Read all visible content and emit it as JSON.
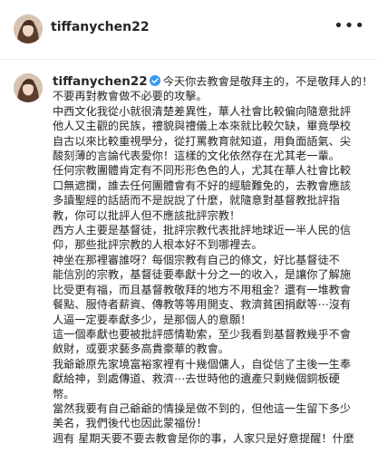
{
  "header": {
    "username": "tiffanychen22",
    "more_icon": "more-horizontal-icon"
  },
  "caption": {
    "username": "tiffanychen22",
    "verified_icon": "verified-badge-icon",
    "lines": [
      "今天你去教會是敬拜主的，不是敬拜人的！",
      "不要再對教會做不必要的攻擊。",
      "中西文化我從小就很清楚差異性，華人社會比較偏向隨意批評",
      "他人又主觀的民族，禮貌與禮儀上本來就比較欠缺，畢竟學校",
      "自古以來比較重視學分，從打罵教育就知道，用負面語氣、尖",
      "酸刻薄的言論代表愛你！這樣的文化依然存在尤其老一輩。",
      "任何宗教團體肯定有不同形形色色的人，尤其在華人社會比較",
      "口無遮攔，誰去任何團體會有不好的經驗難免的，去教會應該",
      "多讀聖經的話語而不是說說了什麼，就隨意對基督教批評指",
      "教，你可以批評人但不應該批評宗教！",
      "西方人主要是基督徒，批評宗教代表批評地球近一半人民的信",
      "仰，那些批評宗教的人根本好不到哪裡去。",
      "神坐在那裡審誰呀？每個宗教有自己的條文，好比基督徒不",
      "能信別的宗教，基督徒要奉獻十分之一的收入，是讓你了解施",
      "比受更有福，而且基督教敬拜的地方不用租金？還有一堆教會",
      "餐點、服侍者薪資、傳教等等用開支、救濟貧困捐獻等⋯沒有",
      "人逼一定要奉獻多少，是那個人的意願！",
      "這一個奉獻也要被批評感情勒索，至少我看到基督教幾乎不會",
      "斂財，或要求藝多高貴豪華的教會。",
      "我爺爺原先家境富裕家裡有十幾個傭人，自從信了主後一生奉",
      "獻給神，到處傳道、救濟⋯去世時他的遺產只剩幾個銅板硬",
      "幣。",
      "當然我要有自己爺爺的情操是做不到的，但他這一生留下多少",
      "美名，我們後代也因此蒙福份！",
      "週有 星期天要不要去教會是你的事，人家只是好意提醒！什麼"
    ]
  },
  "colors": {
    "text": "#262626",
    "verified": "#3897f0",
    "divider": "#efefef"
  }
}
